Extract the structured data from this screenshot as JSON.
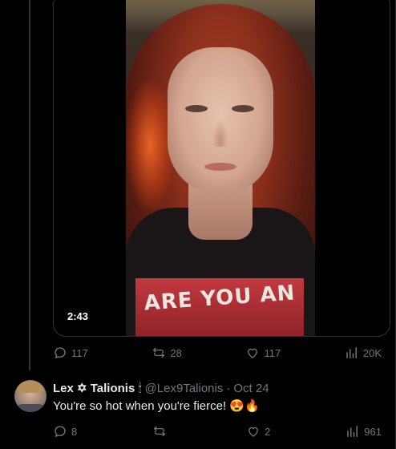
{
  "video": {
    "duration": "2:43",
    "shirt_text": "ARE YOU AN"
  },
  "tweet_actions": {
    "replies": "117",
    "reposts": "28",
    "likes": "117",
    "views": "20K"
  },
  "reply": {
    "display_name": "Lex ✡ Talionis",
    "badge_emoji": "🕯",
    "handle": "@Lex9Talionis",
    "separator": "·",
    "date": "Oct 24",
    "text": "You're so hot when you're fierce! 😍🔥",
    "actions": {
      "replies": "8",
      "reposts": "",
      "likes": "2",
      "views": "961"
    }
  }
}
